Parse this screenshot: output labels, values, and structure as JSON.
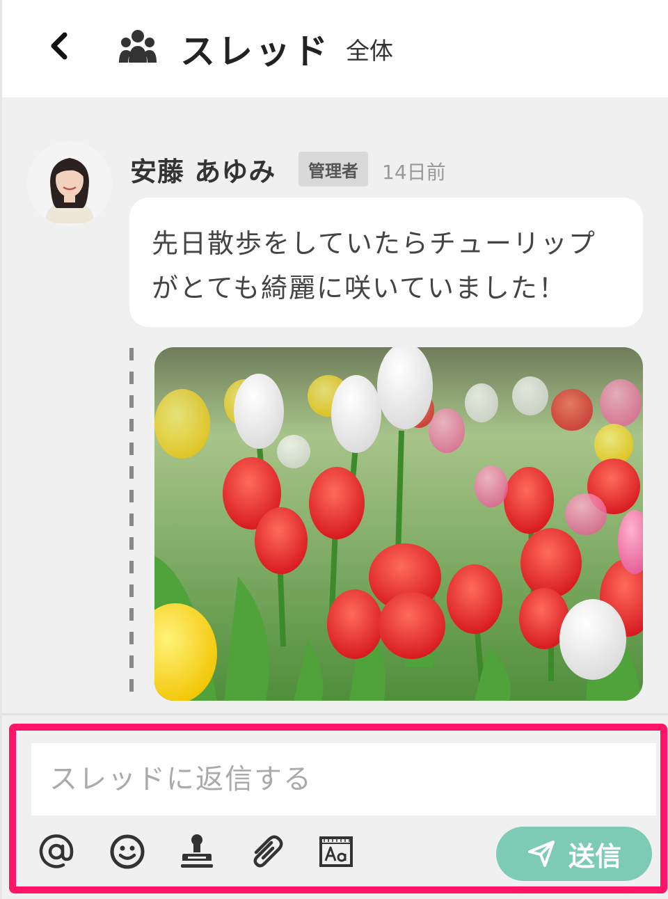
{
  "header": {
    "back_icon": "chevron-left-icon",
    "group_icon": "group-icon",
    "title": "スレッド",
    "scope": "全体"
  },
  "message": {
    "author": "安藤 あゆみ",
    "role": "管理者",
    "time": "14日前",
    "text_line1": "先日散歩をしていたらチューリップ",
    "text_line2": "がとても綺麗に咲いていました！",
    "attachment": "tulip-photo"
  },
  "composer": {
    "placeholder": "スレッドに返信する",
    "tools": [
      "mention-icon",
      "emoji-icon",
      "stamp-icon",
      "attachment-icon",
      "text-format-icon"
    ],
    "send_label": "送信",
    "send_color": "#7dcab5",
    "highlight_color": "#ff1468"
  }
}
